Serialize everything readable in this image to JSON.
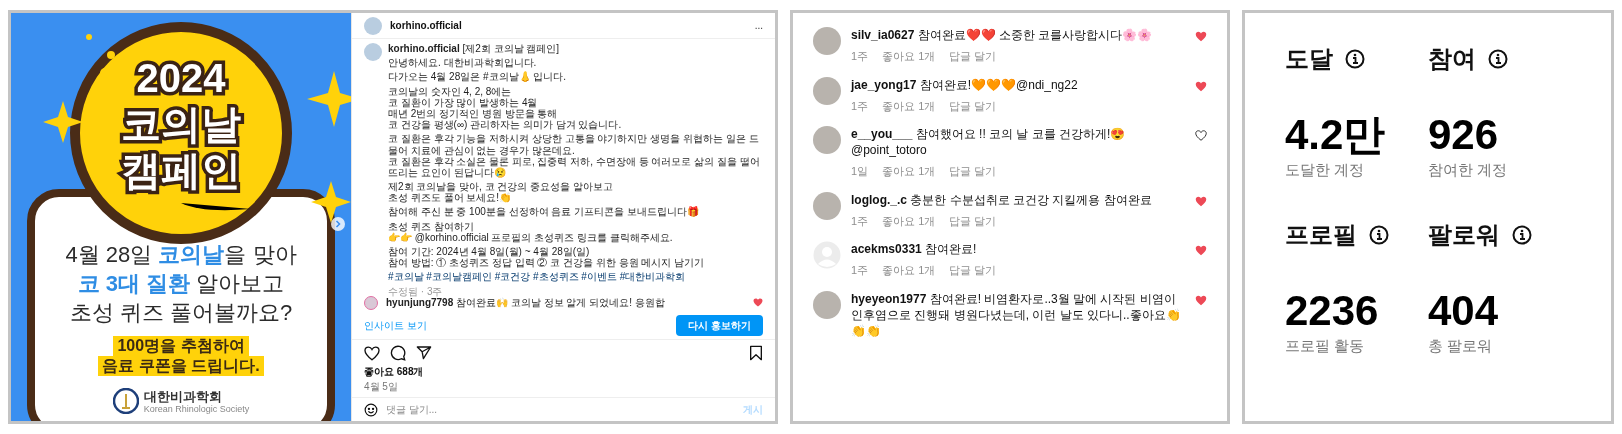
{
  "post": {
    "image": {
      "title_lines": [
        "2024",
        "코의날",
        "캠페인"
      ],
      "body_lines": [
        [
          {
            "text": "4월 28일 ",
            "accent": false
          },
          {
            "text": "코의날",
            "accent": true
          },
          {
            "text": "을 맞아",
            "accent": false
          }
        ],
        [
          {
            "text": "코 3대 질환",
            "accent": true
          },
          {
            "text": " 알아보고",
            "accent": false
          }
        ],
        [
          {
            "text": "초성 퀴즈 풀어볼까요?",
            "accent": false
          }
        ]
      ],
      "highlight_lines": [
        "100명을 추첨하여",
        "음료 쿠폰을 드립니다."
      ],
      "logo_name": "대한비과학회",
      "logo_subtitle": "Korean Rhinologic Society"
    },
    "author": "korhino.official",
    "more": "...",
    "caption": {
      "author": "korhino.official",
      "title": "[제2회 코의날 캠페인]",
      "paragraphs": [
        {
          "kind": "text",
          "text": "안녕하세요. 대한비과학회입니다."
        },
        {
          "kind": "text",
          "text": "다가오는 4월 28일은 #코의날👃 입니다."
        },
        {
          "kind": "text",
          "text": "코의날의 숫자인 4, 2, 8에는\n코 질환이 가장 많이 발생하는 4월\n매년 2번의 정기적인 병원 방문을 통해\n코 건강을 평생(∞) 관리하자는 의미가 담겨 있습니다."
        },
        {
          "kind": "text",
          "text": "코 질환은 후각 기능을 저하시켜 상당한 고통을 야기하지만 생명을 위협하는 일은 드물어 치료에 관심이 없는 경우가 많은데요.\n코 질환은 후각 소실은 물론 피로, 집중력 저하, 수면장애 등 여러모로 삶의 질을 떨어뜨리는 요인이 된답니다😢"
        },
        {
          "kind": "text",
          "text": "제2회 코의날을 맞아, 코 건강의 중요성을 알아보고\n초성 퀴즈도 풀어 보세요!👏"
        },
        {
          "kind": "text",
          "text": "참여해 주신 분 중 100분을 선정하여 음료 기프티콘을 보내드립니다🎁"
        },
        {
          "kind": "text",
          "text": "초성 퀴즈 참여하기\n👉👉 @korhino.official 프로필의 초성퀴즈 링크를 클릭해주세요."
        },
        {
          "kind": "text",
          "text": "참여 기간: 2024년 4월 8일(월) ~ 4월 28일(일)\n참여 방법: ① 초성퀴즈 정답 입력 ② 코 건강을 위한 응원 메시지 남기기"
        },
        {
          "kind": "hashtags",
          "text": "#코의날 #코의날캠페인 #코건강 #초성퀴즈 #이벤트 #대한비과학회"
        }
      ],
      "edited": "수정됨 · 3주"
    },
    "top_comment": {
      "user": "hyunjung7798",
      "text": "참여완료🙌 코의날 정보 알게 되었네요! 응원합",
      "liked": true
    },
    "insights_link": "인사이트 보기",
    "boost_button": "다시 홍보하기",
    "likes": "좋아요 688개",
    "date": "4월 5일",
    "comment_field": {
      "placeholder": "댓글 달기..."
    },
    "post_button": "게시"
  },
  "comments": [
    {
      "default_avatar": false,
      "user": "silv_ia0627",
      "text": "참여완료❤️❤️ 소중한 코를사랑합시다🌸🌸",
      "time": "1주",
      "likes": "좋아요 1개",
      "reply": "답글 달기",
      "liked": true
    },
    {
      "default_avatar": false,
      "user": "jae_yong17",
      "text": "참여완료!🧡🧡🧡@ndi_ng22",
      "time": "1주",
      "likes": "좋아요 1개",
      "reply": "답글 달기",
      "liked": true
    },
    {
      "default_avatar": false,
      "user": "e__you___",
      "text": "참여했어요 !! 코의 날 코를 건강하게!😍 @point_totoro",
      "time": "1일",
      "likes": "좋아요 1개",
      "reply": "답글 달기",
      "liked": false
    },
    {
      "default_avatar": false,
      "user": "loglog._.c",
      "text": "충분한 수분섭취로 코건강 지킬께용 참여완료",
      "time": "1주",
      "likes": "좋아요 1개",
      "reply": "답글 달기",
      "liked": true
    },
    {
      "default_avatar": true,
      "user": "acekms0331",
      "text": "참여완료!",
      "time": "1주",
      "likes": "좋아요 1개",
      "reply": "답글 달기",
      "liked": true
    },
    {
      "default_avatar": false,
      "user": "hyeyeon1977",
      "text": "참여완료! 비염환자로..3월 말에 시작된 비염이 인후염으로 진행돼 병원다녔는데, 이런 날도 있다니..좋아요👏👏👏",
      "liked": true
    }
  ],
  "stats": [
    {
      "title": "도달",
      "value": "4.2만",
      "label": "도달한 계정"
    },
    {
      "title": "참여",
      "value": "926",
      "label": "참여한 계정"
    },
    {
      "title": "프로필",
      "value": "2236",
      "label": "프로필 활동"
    },
    {
      "title": "팔로워",
      "value": "404",
      "label": "총 팔로워"
    }
  ]
}
